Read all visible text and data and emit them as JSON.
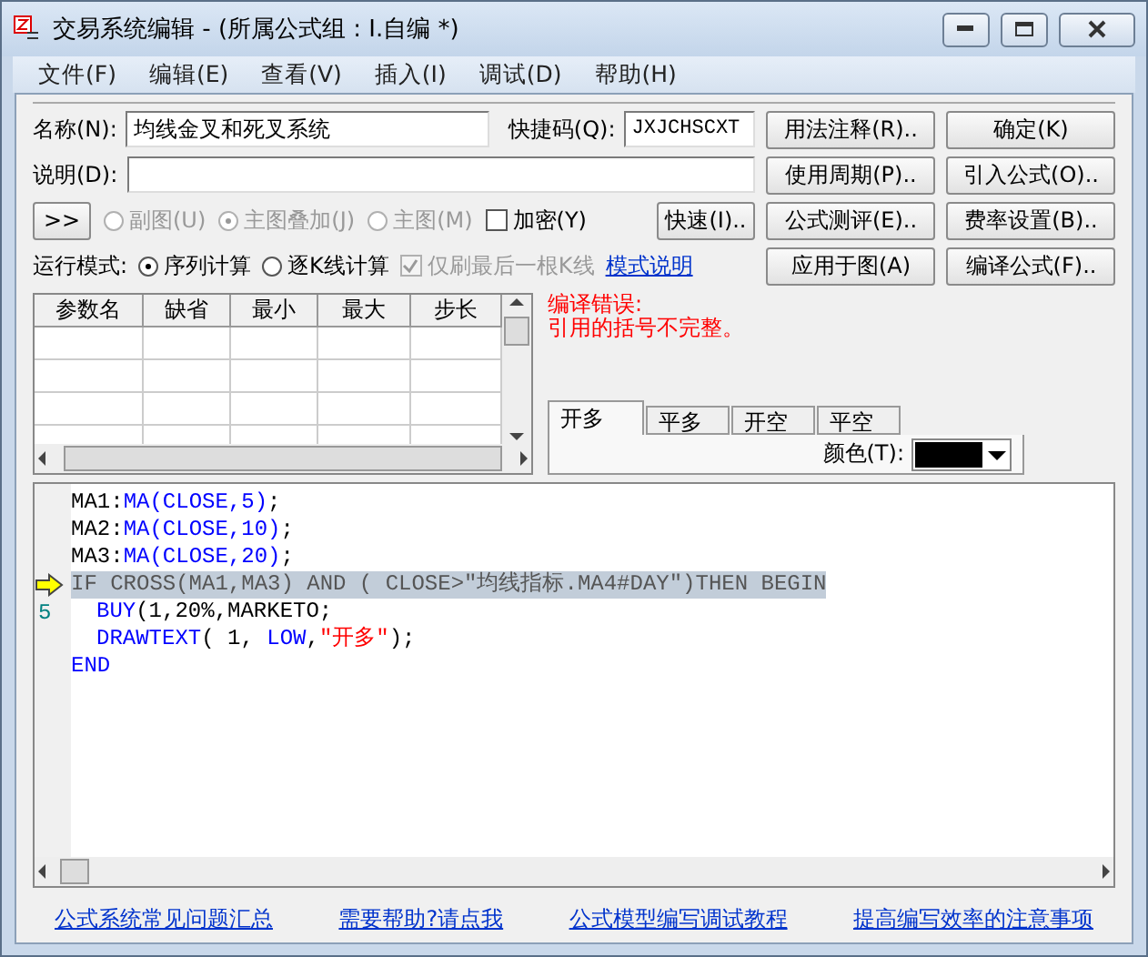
{
  "window": {
    "title": "交易系统编辑 - (所属公式组 : I.自编 *)"
  },
  "menu": [
    "文件(F)",
    "编辑(E)",
    "查看(V)",
    "插入(I)",
    "调试(D)",
    "帮助(H)"
  ],
  "name_field": {
    "label": "名称(N):",
    "value": "均线金叉和死叉系统"
  },
  "shortcut_field": {
    "label": "快捷码(Q):",
    "value": "JXJCHSCXT"
  },
  "description_field": {
    "label": "说明(D):"
  },
  "expand_button": ">>",
  "chart_options": [
    {
      "label": "副图(U)",
      "selected": false,
      "disabled": true
    },
    {
      "label": "主图叠加(J)",
      "selected": true,
      "disabled": true
    },
    {
      "label": "主图(M)",
      "selected": false,
      "disabled": true
    }
  ],
  "encrypt": {
    "label": "加密(Y)",
    "checked": false
  },
  "quick_button": "快速(I)..",
  "run_mode": {
    "label": "运行模式:",
    "options": [
      {
        "label": "序列计算",
        "selected": true
      },
      {
        "label": "逐K线计算",
        "selected": false
      }
    ],
    "last_bar_only": {
      "label": "仅刷最后一根K线",
      "checked": true,
      "disabled": true
    },
    "help_link": "模式说明"
  },
  "buttons": [
    "用法注释(R)..",
    "确定(K)",
    "使用周期(P)..",
    "引入公式(O)..",
    "公式测评(E)..",
    "费率设置(B)..",
    "应用于图(A)",
    "编译公式(F).."
  ],
  "params_table": {
    "columns": [
      "参数名",
      "缺省",
      "最小",
      "最大",
      "步长"
    ]
  },
  "error": {
    "title": "编译错误:",
    "message": "引用的括号不完整。"
  },
  "signal_tabs": [
    {
      "label": "开多",
      "selected": true
    },
    {
      "label": "平多",
      "selected": false
    },
    {
      "label": "开空",
      "selected": false
    },
    {
      "label": "平空",
      "selected": false
    }
  ],
  "color_field": {
    "label": "颜色(T):",
    "color": "#000000"
  },
  "editor": {
    "lines": [
      {
        "marker": false,
        "selected": false,
        "indented": false,
        "segments": [
          {
            "kind": "plain",
            "text": "MA1:"
          },
          {
            "kind": "keyword",
            "text": "MA(CLOSE,5)"
          },
          {
            "kind": "plain",
            "text": ";"
          }
        ]
      },
      {
        "marker": false,
        "selected": false,
        "indented": false,
        "segments": [
          {
            "kind": "plain",
            "text": "MA2:"
          },
          {
            "kind": "keyword",
            "text": "MA(CLOSE,10)"
          },
          {
            "kind": "plain",
            "text": ";"
          }
        ]
      },
      {
        "marker": false,
        "selected": false,
        "indented": false,
        "segments": [
          {
            "kind": "plain",
            "text": "MA3:"
          },
          {
            "kind": "keyword",
            "text": "MA(CLOSE,20)"
          },
          {
            "kind": "plain",
            "text": ";"
          }
        ]
      },
      {
        "marker": true,
        "selected": true,
        "indented": false,
        "segments": [
          {
            "kind": "plain",
            "text": "IF CROSS(MA1,MA3) AND ( CLOSE>\"均线指标.MA4#DAY\")THEN BEGIN"
          }
        ]
      },
      {
        "number": "5",
        "marker": false,
        "selected": false,
        "indented": true,
        "segments": [
          {
            "kind": "keyword",
            "text": "BUY"
          },
          {
            "kind": "plain",
            "text": "(1,20%,MARKETO;"
          }
        ]
      },
      {
        "marker": false,
        "selected": false,
        "indented": true,
        "segments": [
          {
            "kind": "keyword",
            "text": "DRAWTEXT"
          },
          {
            "kind": "plain",
            "text": "( 1, "
          },
          {
            "kind": "keyword",
            "text": "LOW"
          },
          {
            "kind": "plain",
            "text": ","
          },
          {
            "kind": "string",
            "text": "\"开多\""
          },
          {
            "kind": "plain",
            "text": ");"
          }
        ]
      },
      {
        "marker": false,
        "selected": false,
        "indented": false,
        "segments": [
          {
            "kind": "keyword",
            "text": "END"
          }
        ]
      }
    ]
  },
  "footer_links": [
    "公式系统常见问题汇总",
    "需要帮助?请点我",
    "公式模型编写调试教程",
    "提高编写效率的注意事项"
  ]
}
